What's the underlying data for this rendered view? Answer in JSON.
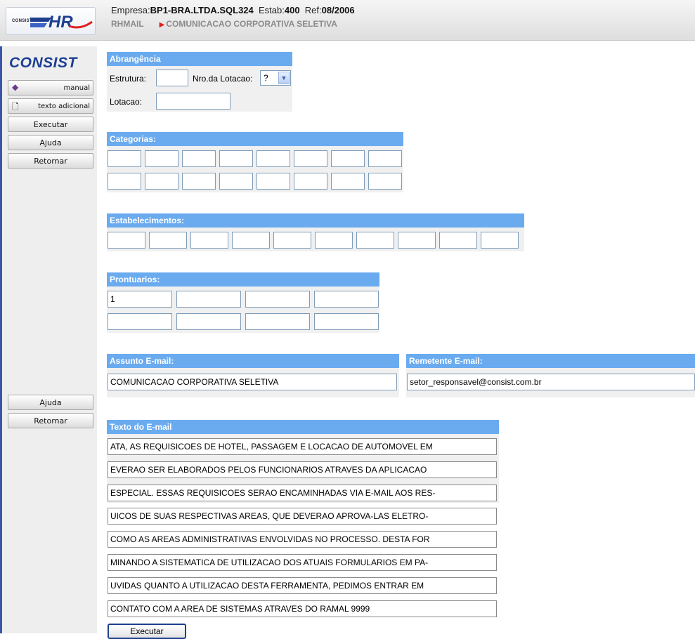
{
  "header": {
    "empresa_label": "Empresa:",
    "empresa_value": "BP1-BRA.LTDA.SQL324",
    "estab_label": "Estab:",
    "estab_value": "400",
    "ref_label": "Ref:",
    "ref_value": "08/2006",
    "module": "RHMAIL",
    "screen_title": "COMUNICACAO CORPORATIVA SELETIVA",
    "logo_small": "CONSIST",
    "logo_large": "HR"
  },
  "sidebar": {
    "brand": "CONSIST",
    "manual": "manual",
    "texto_adicional": "texto adicional",
    "executar": "Executar",
    "ajuda": "Ajuda",
    "retornar": "Retornar",
    "ajuda_bottom": "Ajuda",
    "retornar_bottom": "Retornar"
  },
  "abrangencia": {
    "title": "Abrangência",
    "estrutura_label": "Estrutura:",
    "estrutura_value": "",
    "nro_lotacao_label": "Nro.da Lotacao:",
    "nro_lotacao_value": "?",
    "lotacao_label": "Lotacao:",
    "lotacao_value": ""
  },
  "categorias": {
    "title": "Categorias:",
    "values": [
      "",
      "",
      "",
      "",
      "",
      "",
      "",
      "",
      "",
      "",
      "",
      "",
      "",
      "",
      "",
      ""
    ]
  },
  "estabelecimentos": {
    "title": "Estabelecimentos:",
    "values": [
      "",
      "",
      "",
      "",
      "",
      "",
      "",
      "",
      "",
      ""
    ]
  },
  "prontuarios": {
    "title": "Prontuarios:",
    "values": [
      "1",
      "",
      "",
      "",
      "",
      "",
      "",
      ""
    ]
  },
  "assunto": {
    "title": "Assunto E-mail:",
    "value": "COMUNICACAO CORPORATIVA SELETIVA"
  },
  "remetente": {
    "title": "Remetente E-mail:",
    "value": "setor_responsavel@consist.com.br"
  },
  "texto_email": {
    "title": "Texto do E-mail",
    "lines": [
      "ATA, AS REQUISICOES DE HOTEL, PASSAGEM E LOCACAO DE AUTOMOVEL EM",
      "EVERAO SER ELABORADOS PELOS FUNCIONARIOS ATRAVES DA  APLICACAO",
      "ESPECIAL. ESSAS REQUISICOES SERAO ENCAMINHADAS VIA E-MAIL AOS RES-",
      "UICOS DE SUAS RESPECTIVAS AREAS, QUE DEVERAO APROVA-LAS ELETRO-",
      "COMO AS AREAS ADMINISTRATIVAS ENVOLVIDAS NO PROCESSO. DESTA FOR",
      "MINANDO A SISTEMATICA DE UTILIZACAO DOS ATUAIS FORMULARIOS EM PA-",
      "UVIDAS QUANTO A UTILIZACAO DESTA FERRAMENTA, PEDIMOS ENTRAR EM",
      "CONTATO COM A AREA DE SISTEMAS ATRAVES DO RAMAL 9999"
    ]
  },
  "executar_button": "Executar"
}
